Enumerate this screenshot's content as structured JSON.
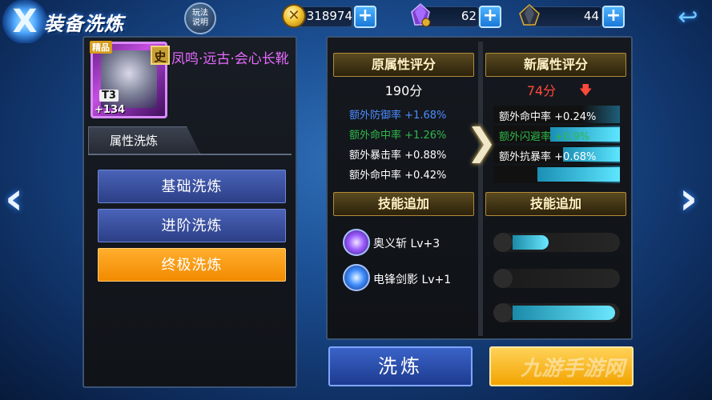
{
  "header": {
    "logo_glyph": "X",
    "title": "装备洗炼",
    "help_line1": "玩法",
    "help_line2": "说明",
    "back_glyph": "↩"
  },
  "resources": {
    "coins": "318974",
    "coin_glyph": "✕",
    "purple_crystal": "62",
    "dark_crystal": "44",
    "plus": "+"
  },
  "item": {
    "quality_badge": "精品",
    "grade_badge": "史",
    "tier": "T3",
    "level": "+134",
    "name": "凤鸣·远古·会心长靴"
  },
  "left_panel": {
    "tab_label": "属性洗炼",
    "options": [
      {
        "label": "基础洗炼",
        "selected": false
      },
      {
        "label": "进阶洗炼",
        "selected": false
      },
      {
        "label": "终极洗炼",
        "selected": true
      }
    ]
  },
  "old_attributes": {
    "header": "原属性评分",
    "score": "190分",
    "lines": [
      {
        "label": "额外防御率",
        "value": "+1.68%",
        "color": "#4c8cff",
        "value_color": "#4c8cff"
      },
      {
        "label": "额外命中率",
        "value": "+1.26%",
        "color": "#2fb84a",
        "value_color": "#2fb84a"
      },
      {
        "label": "额外暴击率",
        "value": "+0.88%",
        "color": "#ffffff",
        "value_color": "#ffffff"
      },
      {
        "label": "额外命中率",
        "value": "+0.42%",
        "color": "#ffffff",
        "value_color": "#ffffff"
      }
    ]
  },
  "new_attributes": {
    "header": "新属性评分",
    "score": "74分",
    "trend_glyph": "🡇",
    "lines": [
      {
        "label": "额外命中率",
        "value": "+0.24%",
        "color": "#ffffff",
        "value_color": "#ffffff",
        "fill": 0.0
      },
      {
        "label": "额外闪避率",
        "value": "+0.9%",
        "color": "#2fb84a",
        "value_color": "#2fb84a",
        "fill": 0.55
      },
      {
        "label": "额外抗暴率",
        "value": "+0.68%",
        "color": "#ffffff",
        "value_color": "#ffffff",
        "fill": 0.45
      },
      {
        "label": "",
        "value": "",
        "color": "#ffffff",
        "value_color": "#ffffff",
        "fill": 0.65
      }
    ]
  },
  "skills_old": {
    "header": "技能追加",
    "items": [
      {
        "name": "奥义斩 Lv+3",
        "icon_color": "#9b5cff"
      },
      {
        "name": "电锋剑影 Lv+1",
        "icon_color": "#3f8dff"
      }
    ]
  },
  "skills_new": {
    "header": "技能追加",
    "bars": [
      0.45,
      0.0,
      0.95
    ]
  },
  "compare_glyph": "❯",
  "actions": {
    "refine": "洗炼",
    "watermark": "九游手游网"
  },
  "nav": {
    "left": "‹",
    "right": "›"
  }
}
